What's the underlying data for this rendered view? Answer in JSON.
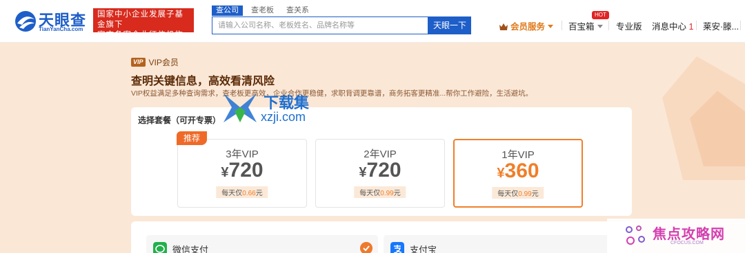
{
  "header": {
    "logo": {
      "name": "天眼查",
      "sub": "TianYanCha.com"
    },
    "banner": {
      "line1": "国家中小企业发展子基金旗下",
      "line2": "官方备案企业征信机构"
    },
    "search": {
      "tabs": [
        {
          "label": "查公司"
        },
        {
          "label": "查老板"
        },
        {
          "label": "查关系"
        }
      ],
      "placeholder": "请输入公司名称、老板姓名、品牌名称等",
      "button": "天眼一下"
    },
    "nav": {
      "vip": "会员服务",
      "toolbox": "百宝箱",
      "hot_badge": "HOT",
      "pro": "专业版",
      "messages": "消息中心",
      "messages_count": "1",
      "user": "莱安·滕..."
    }
  },
  "vip": {
    "badge": "VIP",
    "tag": "VIP会员",
    "headline": "查明关键信息，高效看清风险",
    "subline": "VIP权益满足多种查询需求，查老板更高效，企业合作更稳健，求职背调更靠谱，商务拓客更精准...帮你工作避险，生活避坑。"
  },
  "plans": {
    "title": "选择套餐（可开专票）",
    "recommend": "推荐",
    "items": [
      {
        "name": "3年VIP",
        "currency": "¥",
        "price": "720",
        "daily_prefix": "每天仅",
        "daily": "0.66",
        "daily_suffix": "元",
        "selected": false
      },
      {
        "name": "2年VIP",
        "currency": "¥",
        "price": "720",
        "daily_prefix": "每天仅",
        "daily": "0.99",
        "daily_suffix": "元",
        "selected": false
      },
      {
        "name": "1年VIP",
        "currency": "¥",
        "price": "360",
        "daily_prefix": "每天仅",
        "daily": "0.99",
        "daily_suffix": "元",
        "selected": true
      }
    ]
  },
  "payment": {
    "methods": [
      {
        "label": "微信支付",
        "icon": "wechat-pay-icon",
        "selected": true
      },
      {
        "label": "支付宝",
        "icon": "alipay-icon",
        "selected": false
      }
    ]
  },
  "watermarks": {
    "top": {
      "text": "下载集",
      "url": "xzji.com"
    },
    "bottom": {
      "text": "焦点攻略网",
      "url": "CFOCUS.COM"
    }
  },
  "colors": {
    "brand_blue": "#1e5ec8",
    "accent_orange": "#f07e2a",
    "banner_red": "#d82a1d",
    "bg_peach": "#fbe7d6"
  }
}
